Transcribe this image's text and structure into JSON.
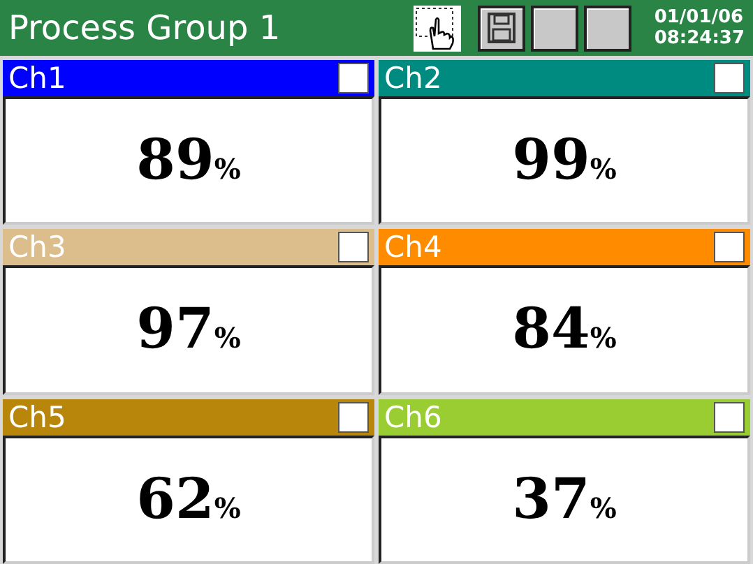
{
  "title": "Process Group 1",
  "toolbar": [
    {
      "kind": "touch"
    },
    {
      "kind": "save"
    },
    {
      "kind": "blank"
    },
    {
      "kind": "blank"
    }
  ],
  "date": "01/01/06",
  "time": "08:24:37",
  "channels": [
    {
      "name": "Ch1",
      "color": "#0000ff",
      "value": "89",
      "unit": "%"
    },
    {
      "name": "Ch2",
      "color": "#008b80",
      "value": "99",
      "unit": "%"
    },
    {
      "name": "Ch3",
      "color": "#dcbd8c",
      "value": "97",
      "unit": "%"
    },
    {
      "name": "Ch4",
      "color": "#ff8c00",
      "value": "84",
      "unit": "%"
    },
    {
      "name": "Ch5",
      "color": "#b8860b",
      "value": "62",
      "unit": "%"
    },
    {
      "name": "Ch6",
      "color": "#9acd32",
      "value": "37",
      "unit": "%"
    }
  ]
}
